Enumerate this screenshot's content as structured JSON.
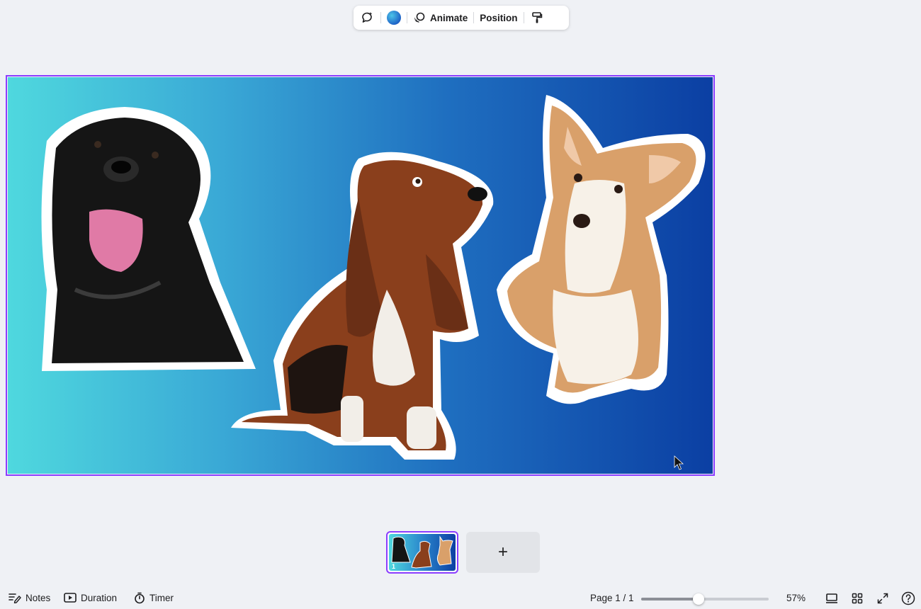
{
  "toolbar": {
    "animate_label": "Animate",
    "position_label": "Position",
    "color_swatch": "#1e64c8"
  },
  "canvas": {
    "background_start": "#4fd8de",
    "background_end": "#0b3fa3",
    "stickers": [
      "black-labrador-sticker",
      "basset-hound-sticker",
      "corgi-sticker"
    ]
  },
  "pages": {
    "thumbnail_number": "1",
    "add_page_label": "+"
  },
  "bottombar": {
    "notes_label": "Notes",
    "duration_label": "Duration",
    "timer_label": "Timer",
    "page_indicator": "Page 1 / 1",
    "zoom_level": "57%",
    "zoom_fraction": 0.45
  }
}
